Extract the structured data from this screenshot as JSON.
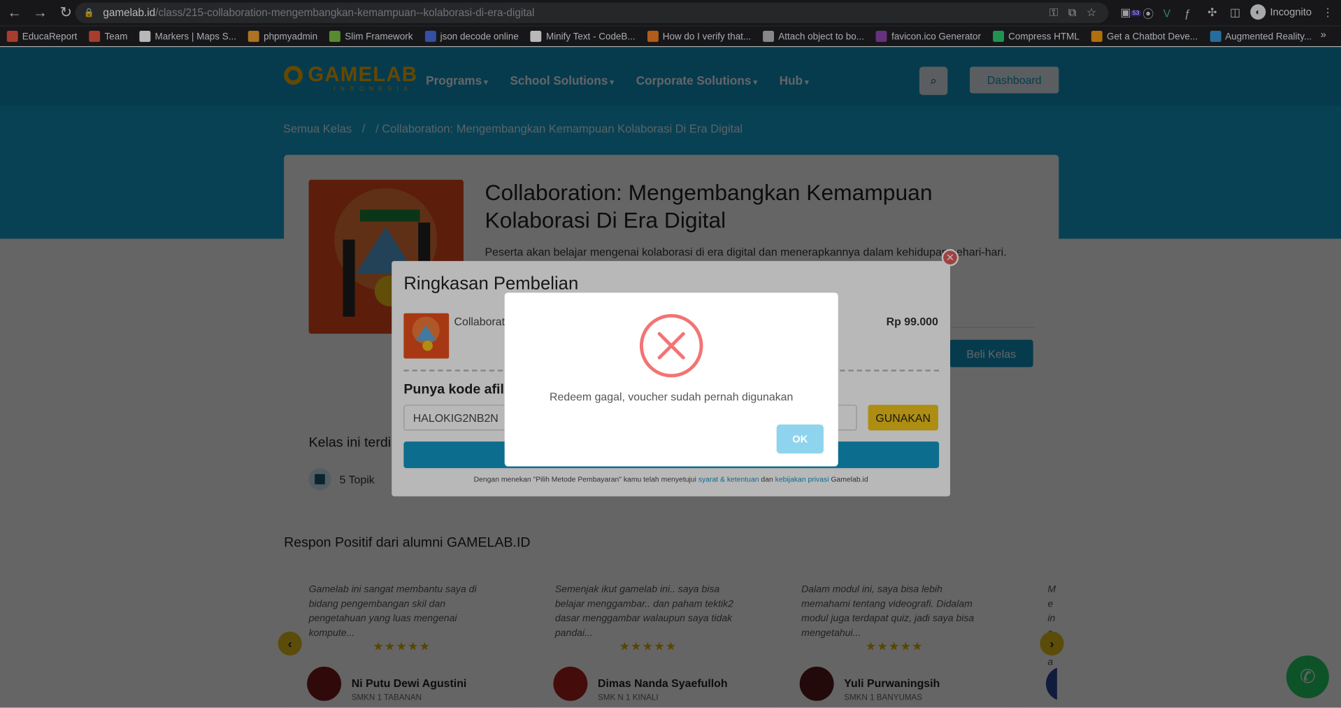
{
  "browser": {
    "url_host": "gamelab.id",
    "url_path": "/class/215-collaboration-mengembangkan-kemampuan--kolaborasi-di-era-digital",
    "profile_label": "Incognito",
    "extension_badge": "53",
    "bookmarks": [
      {
        "label": "EducaReport",
        "color": "#e8553f"
      },
      {
        "label": "Team",
        "color": "#e8553f"
      },
      {
        "label": "Markers | Maps S...",
        "color": "#ffffff"
      },
      {
        "label": "phpmyadmin",
        "color": "#f0a030"
      },
      {
        "label": "Slim Framework",
        "color": "#7ac143"
      },
      {
        "label": "json decode online",
        "color": "#4a6fe0"
      },
      {
        "label": "Minify Text - CodeB...",
        "color": "#ffffff"
      },
      {
        "label": "How do I verify that...",
        "color": "#f48024"
      },
      {
        "label": "Attach object to bo...",
        "color": "#bbbbbb"
      },
      {
        "label": "favicon.ico Generator",
        "color": "#8e44ad"
      },
      {
        "label": "Compress HTML",
        "color": "#2ecc71"
      },
      {
        "label": "Get a Chatbot Deve...",
        "color": "#f39c12"
      },
      {
        "label": "Augmented Reality...",
        "color": "#3498db"
      }
    ]
  },
  "site": {
    "logo": "GAMELAB",
    "logo_sub": "INDONESIA",
    "menu": [
      "Programs",
      "School Solutions",
      "Corporate Solutions",
      "Hub"
    ],
    "dashboard_label": "Dashboard",
    "breadcrumb": [
      "Semua Kelas",
      "/",
      "/ Collaboration: Mengembangkan Kemampuan Kolaborasi Di Era Digital"
    ]
  },
  "course": {
    "title": "Collaboration: Mengembangkan Kemampuan Kolaborasi Di Era Digital",
    "description": "Peserta akan belajar mengenai kolaborasi di era digital dan menerapkannya dalam kehidupan sehari-hari.",
    "buy_label": "Beli Kelas",
    "includes_heading": "Kelas ini terdi",
    "topics": "5 Topik"
  },
  "testimonials": {
    "heading": "Respon Positif dari alumni GAMELAB.ID",
    "items": [
      {
        "quote": "Gamelab ini sangat membantu saya di bidang pengembangan skil dan pengetahuan yang luas mengenai kompute...",
        "name": "Ni Putu Dewi Agustini",
        "school": "SMKN 1 TABANAN",
        "rating": 5
      },
      {
        "quote": "Semenjak ikut gamelab ini.. saya bisa belajar menggambar.. dan paham tektik2 dasar menggambar walaupun saya tidak pandai...",
        "name": "Dimas Nanda Syaefulloh",
        "school": "SMK N 1 KINALI",
        "rating": 5
      },
      {
        "quote": "Dalam modul ini, saya bisa lebih memahami tentang videografi. Didalam modul juga terdapat quiz, jadi saya bisa mengetahui...",
        "name": "Yuli Purwaningsih",
        "school": "SMKN 1 BANYUMAS",
        "rating": 5
      },
      {
        "quote": "Me inc ya",
        "name": "",
        "school": "",
        "rating": 0
      }
    ],
    "stars": "★★★★★"
  },
  "summary": {
    "title": "Ringkasan Pembelian",
    "item_name": "Collaborat",
    "price": "Rp 99.000",
    "affiliate_heading": "Punya kode afili",
    "code_value": "HALOKIG2NB2N",
    "use_label": "GUNAKAN",
    "terms_prefix": "Dengan menekan \"Pilih Metode Pembayaran\" kamu telah menyetujui",
    "terms_link1": "syarat & ketentuan",
    "terms_and": "dan",
    "terms_link2": "kebijakan privasi",
    "terms_suffix": "Gamelab.id"
  },
  "alert": {
    "message": "Redeem gagal, voucher sudah pernah digunakan",
    "ok_label": "OK"
  }
}
